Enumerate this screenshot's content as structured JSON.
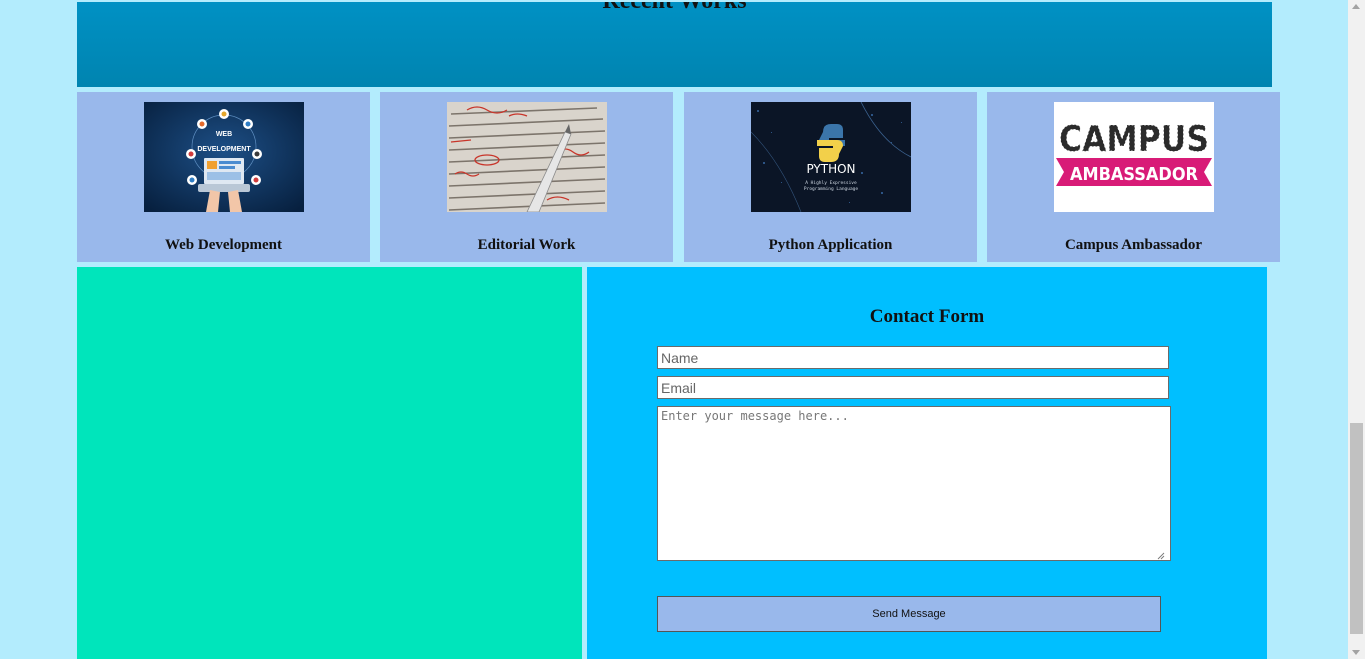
{
  "recent_works": {
    "title": "Recent Works"
  },
  "works": [
    {
      "caption": "Web Development",
      "icon": "web-development-image",
      "image_text": "WEB DEVELOPMENT"
    },
    {
      "caption": "Editorial Work",
      "icon": "editorial-proofreading-image"
    },
    {
      "caption": "Python Application",
      "icon": "python-image",
      "image_text": "PYTHON",
      "image_subtext": "A Highly Expressive Programming Language"
    },
    {
      "caption": "Campus Ambassador",
      "icon": "campus-ambassador-image",
      "image_text": "CAMPUS",
      "image_subtext": "AMBASSADOR"
    }
  ],
  "contact": {
    "title": "Contact Form",
    "name_placeholder": "Name",
    "email_placeholder": "Email",
    "message_placeholder": "Enter your message here...",
    "send_label": "Send Message"
  },
  "colors": {
    "page_bg": "#b3ecfd",
    "header_bg": "#0089b8",
    "card_bg": "#99b8eb",
    "green_panel": "#00e5bb",
    "contact_panel": "#00bfff",
    "button_bg": "#99b8eb"
  }
}
